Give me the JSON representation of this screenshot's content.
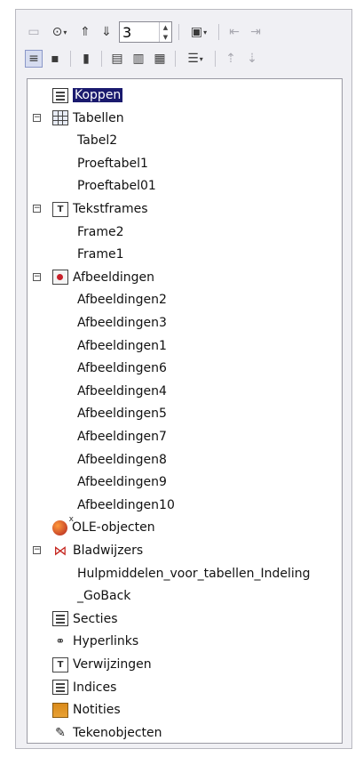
{
  "toolbar": {
    "row1": [
      {
        "name": "toggle-icon",
        "glyph": "▭",
        "faded": true
      },
      {
        "name": "navigation-icon",
        "glyph": "⊙",
        "dropdown": true
      },
      {
        "name": "promote-chapter-icon",
        "glyph": "⇑"
      },
      {
        "name": "demote-chapter-icon",
        "glyph": "⇓"
      }
    ],
    "level_value": "3",
    "row1_after": [
      {
        "name": "drag-mode-icon",
        "glyph": "▣",
        "dropdown": true
      },
      {
        "name": "promote-level-icon",
        "glyph": "⇤",
        "faded": true
      },
      {
        "name": "demote-level-icon",
        "glyph": "⇥",
        "faded": true
      }
    ],
    "row2": [
      {
        "name": "content-view-icon",
        "glyph": "≡",
        "active": true
      },
      {
        "name": "set-reminder-icon",
        "glyph": "▪"
      },
      {
        "name": "header-icon",
        "glyph": "▮"
      },
      {
        "name": "footer-icon",
        "glyph": "▤"
      },
      {
        "name": "anchor-icon",
        "glyph": "▥"
      },
      {
        "name": "documents-icon",
        "glyph": "▦"
      },
      {
        "name": "list-box-icon",
        "glyph": "☰",
        "dropdown": true
      },
      {
        "name": "move-up-icon",
        "glyph": "⇡",
        "faded": true
      },
      {
        "name": "move-down-icon",
        "glyph": "⇣",
        "faded": true
      }
    ]
  },
  "tree": [
    {
      "label": "Koppen",
      "icon": "doc",
      "expander": null,
      "depth": 0,
      "selected": true
    },
    {
      "label": "Tabellen",
      "icon": "table",
      "expander": "−",
      "depth": 0
    },
    {
      "label": "Tabel2",
      "depth": 1
    },
    {
      "label": "Proeftabel1",
      "depth": 1
    },
    {
      "label": "Proeftabel01",
      "depth": 1
    },
    {
      "label": "Tekstframes",
      "icon": "frame",
      "expander": "−",
      "depth": 0
    },
    {
      "label": "Frame2",
      "depth": 1
    },
    {
      "label": "Frame1",
      "depth": 1
    },
    {
      "label": "Afbeeldingen",
      "icon": "img",
      "expander": "−",
      "depth": 0
    },
    {
      "label": "Afbeeldingen2",
      "depth": 1
    },
    {
      "label": "Afbeeldingen3",
      "depth": 1
    },
    {
      "label": "Afbeeldingen1",
      "depth": 1
    },
    {
      "label": "Afbeeldingen6",
      "depth": 1
    },
    {
      "label": "Afbeeldingen4",
      "depth": 1
    },
    {
      "label": "Afbeeldingen5",
      "depth": 1
    },
    {
      "label": "Afbeeldingen7",
      "depth": 1
    },
    {
      "label": "Afbeeldingen8",
      "depth": 1
    },
    {
      "label": "Afbeeldingen9",
      "depth": 1
    },
    {
      "label": "Afbeeldingen10",
      "depth": 1
    },
    {
      "label": "OLE-objecten",
      "icon": "ole",
      "expander": null,
      "depth": 0
    },
    {
      "label": "Bladwijzers",
      "icon": "bmark",
      "expander": "−",
      "depth": 0
    },
    {
      "label": "Hulpmiddelen_voor_tabellen_Indeling",
      "depth": 1
    },
    {
      "label": "_GoBack",
      "depth": 1
    },
    {
      "label": "Secties",
      "icon": "doc",
      "expander": null,
      "depth": 0
    },
    {
      "label": "Hyperlinks",
      "icon": "link",
      "expander": null,
      "depth": 0
    },
    {
      "label": "Verwijzingen",
      "icon": "frame",
      "expander": null,
      "depth": 0
    },
    {
      "label": "Indices",
      "icon": "doc",
      "expander": null,
      "depth": 0
    },
    {
      "label": "Notities",
      "icon": "note",
      "expander": null,
      "depth": 0
    },
    {
      "label": "Tekenobjecten",
      "icon": "draw",
      "expander": null,
      "depth": 0
    }
  ],
  "colors": {
    "selection": "#1a1a6e",
    "panel": "#f0f0f4"
  }
}
